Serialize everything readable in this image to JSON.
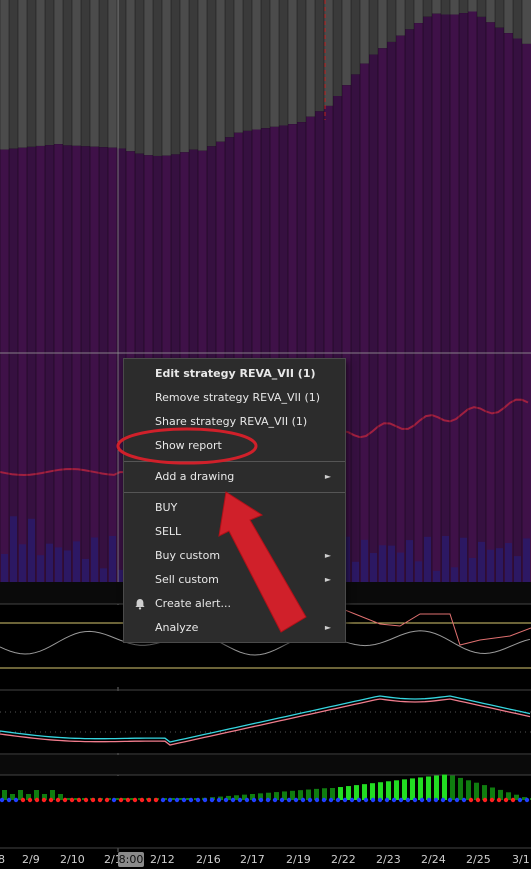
{
  "context_menu": {
    "items": [
      {
        "label": "Edit strategy REVA_VII (1)",
        "bold": true,
        "submenu": false
      },
      {
        "label": "Remove strategy REVA_VII (1)",
        "bold": false,
        "submenu": false
      },
      {
        "label": "Share strategy REVA_VII (1)",
        "bold": false,
        "submenu": false
      },
      {
        "label": "Show report",
        "bold": false,
        "submenu": false,
        "highlighted": true
      },
      {
        "label": "Add a drawing",
        "bold": false,
        "submenu": true
      },
      {
        "label": "BUY",
        "bold": false,
        "submenu": false
      },
      {
        "label": "SELL",
        "bold": false,
        "submenu": false
      },
      {
        "label": "Buy custom",
        "bold": false,
        "submenu": true
      },
      {
        "label": "Sell custom",
        "bold": false,
        "submenu": true
      },
      {
        "label": "Create alert...",
        "bold": false,
        "submenu": false,
        "icon": "bell-icon"
      },
      {
        "label": "Analyze",
        "bold": false,
        "submenu": true
      }
    ]
  },
  "time_axis": {
    "labels": [
      "8",
      "2/9",
      "2/10",
      "2/11",
      "2/12",
      "2/16",
      "2/17",
      "2/19",
      "2/22",
      "2/23",
      "2/24",
      "2/25",
      "3/1"
    ],
    "crosshair_time": "8:00"
  },
  "annotation": {
    "highlight_color": "#d0202a",
    "highlight_target": "Show report",
    "arrow_icon": "arrow-icon"
  },
  "colors": {
    "background": "#000000",
    "purple_fill": "#3d0f45",
    "gray_fill": "#4a4a4a",
    "cyan_line": "#35d6e0",
    "pink_line": "#f07c8c",
    "green_bar": "#22dd22",
    "dark_green_bar": "#0f7d0f",
    "dot_blue": "#2040ff",
    "dot_red": "#ff2020",
    "menu_bg": "#2c2c2c"
  }
}
